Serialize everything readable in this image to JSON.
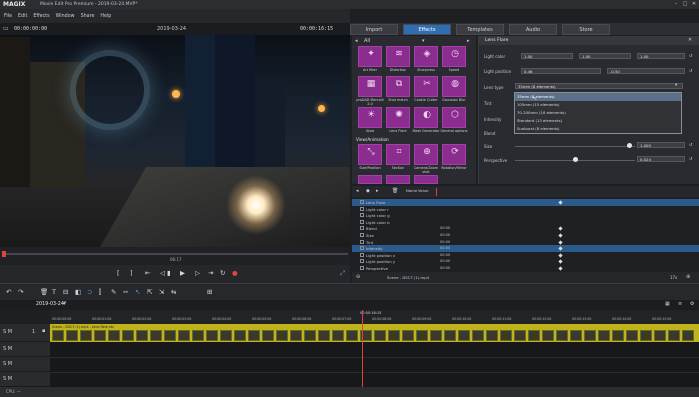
{
  "app": {
    "logo": "MAGIX",
    "title": "Movie Edit Pro Premium - 2019-03-24.MVP*"
  },
  "menu": [
    "File",
    "Edit",
    "Effects",
    "Window",
    "Share",
    "Help"
  ],
  "preview": {
    "timecode_left": "00:00:00:00",
    "date_title": "2019-03-24",
    "timecode_right": "00:00:16:15",
    "scrub_time": "06:17"
  },
  "tabs": [
    "Import",
    "Effects",
    "Templates",
    "Audio",
    "Store"
  ],
  "tabs_active": "Effects",
  "effects": {
    "filter": "All",
    "row1": [
      "Art filter",
      "Distortion",
      "Sharpness",
      "Speed"
    ],
    "row2": [
      "proDAD Mercalli 2.0",
      "Shot match",
      "Cookie Cutter",
      "Gaussian Blur"
    ],
    "row3": [
      "Glow",
      "Lens Flare",
      "Mask Generator",
      "General options"
    ],
    "section": "View/Animation",
    "row4": [
      "Size/Position",
      "Section",
      "Camera/Zoom shot",
      "Rotation/Mirror"
    ]
  },
  "lens_flare": {
    "header": "Lens Flare",
    "lens_color_label": "Light color",
    "lens_color_values": [
      "1.00",
      "1.00",
      "1.00"
    ],
    "position_label": "Light position",
    "position_x": "0.46",
    "position_y": "-0.50",
    "lens_type_label": "Lens type",
    "lens_type_value": "35mm (8 elements)",
    "tint_label": "Tint",
    "intensity_label": "Intensity",
    "blend_label": "Blend",
    "size_label": "Size",
    "size_value": "1.000",
    "perspective_label": "Perspective",
    "perspective_value": "0.024",
    "dropdown_items": [
      "35mm (8 elements)",
      "105mm (15 elements)",
      "70-200mm (16 elements)",
      "Standard (13 elements)",
      "Sunburst (8 elements)"
    ]
  },
  "keyframes": {
    "header_cols": [
      "Name",
      "Value"
    ],
    "timecode": "00:00",
    "rows": [
      {
        "name": "Lens Flare",
        "value": "",
        "selected": true
      },
      {
        "name": "Light color r",
        "value": "",
        "selected": false
      },
      {
        "name": "Light color g",
        "value": "",
        "selected": false
      },
      {
        "name": "Light color b",
        "value": "",
        "selected": false
      },
      {
        "name": "Blend",
        "value": "00:00",
        "selected": false
      },
      {
        "name": "Size",
        "value": "00:00",
        "selected": false
      },
      {
        "name": "Tint",
        "value": "00:00",
        "selected": false
      },
      {
        "name": "Intensity",
        "value": "00:00",
        "selected": true
      },
      {
        "name": "Light position x",
        "value": "00:00",
        "selected": false
      },
      {
        "name": "Light position y",
        "value": "00:00",
        "selected": false
      },
      {
        "name": "Perspective",
        "value": "00:00",
        "selected": false
      }
    ],
    "status_text": "Scene - DSC7 (1).mp4",
    "zoom": "17s"
  },
  "timeline": {
    "project_tab": "2019-03-24*",
    "timecode": "00:00:16:15",
    "ruler": [
      "00:00:00:00",
      "00:00:01:00",
      "00:00:02:00",
      "00:00:03:00",
      "00:00:04:00",
      "00:00:05:00",
      "00:00:06:00",
      "00:00:07:00",
      "00:00:08:00",
      "00:00:09:00",
      "00:00:10:00",
      "00:00:11:00",
      "00:00:12:00",
      "00:00:13:00",
      "00:00:14:00",
      "00:00:15:00"
    ],
    "clip_caption": "Scene - DSC7 (1).mp4 - Lens flare etc",
    "track_label": "1",
    "track_icons": "S M",
    "status": "CPU: —"
  },
  "colors": {
    "accent": "#2f6fb1",
    "tile": "#8b2d8e",
    "track": "#bfb41a"
  }
}
